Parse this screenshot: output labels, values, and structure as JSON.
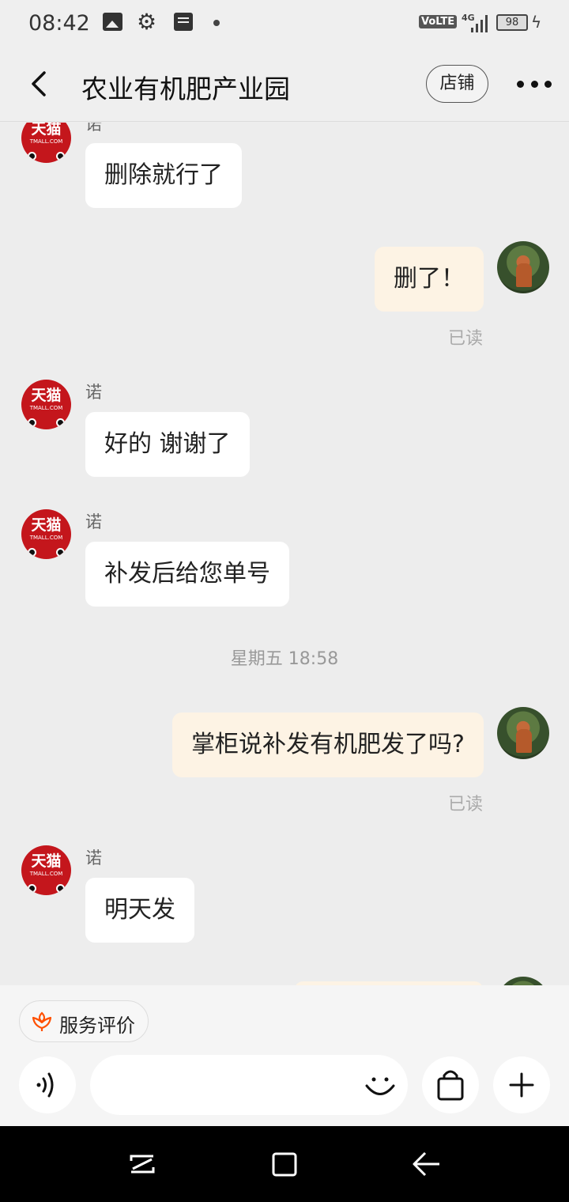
{
  "status_bar": {
    "time": "08:42",
    "network": "VoLTE",
    "signal_label": "4G",
    "battery": "98",
    "icons": [
      "image-icon",
      "gear-icon",
      "message-icon",
      "dot-icon",
      "signal-icon",
      "battery-icon",
      "charging-icon"
    ]
  },
  "header": {
    "back_icon": "chevron-left-icon",
    "title": "农业有机肥产业园",
    "shop_label": "店铺",
    "more_icon": "more-dots-icon"
  },
  "shop_avatar": {
    "logo_text": "天猫",
    "logo_sub": "TMALL.COM",
    "color": "#c4161c"
  },
  "messages": [
    {
      "side": "in",
      "sender": "诺",
      "text": "删除就行了"
    },
    {
      "side": "out",
      "text": "删了！",
      "status": "已读"
    },
    {
      "side": "in",
      "sender": "诺",
      "text": "好的 谢谢了"
    },
    {
      "side": "in",
      "sender": "诺",
      "text": "补发后给您单号"
    },
    {
      "side": "time",
      "text": "星期五 18:58"
    },
    {
      "side": "out",
      "text": "掌柜说补发有机肥发了吗?",
      "status": "已读"
    },
    {
      "side": "in",
      "sender": "诺",
      "text": "明天发"
    }
  ],
  "footer": {
    "rating_label": "服务评价",
    "rating_icon": "flower-icon",
    "voice_icon": "voice-icon",
    "emoji_icon": "smile-icon",
    "bag_icon": "shopping-bag-icon",
    "plus_icon": "plus-icon",
    "input_value": ""
  },
  "system_nav": {
    "icons": [
      "recent-apps-icon",
      "home-icon",
      "back-arrow-icon"
    ]
  },
  "colors": {
    "outgoing_bubble": "#fdf3e4",
    "incoming_bubble": "#ffffff",
    "background": "#ededed",
    "accent": "#ff5000"
  }
}
